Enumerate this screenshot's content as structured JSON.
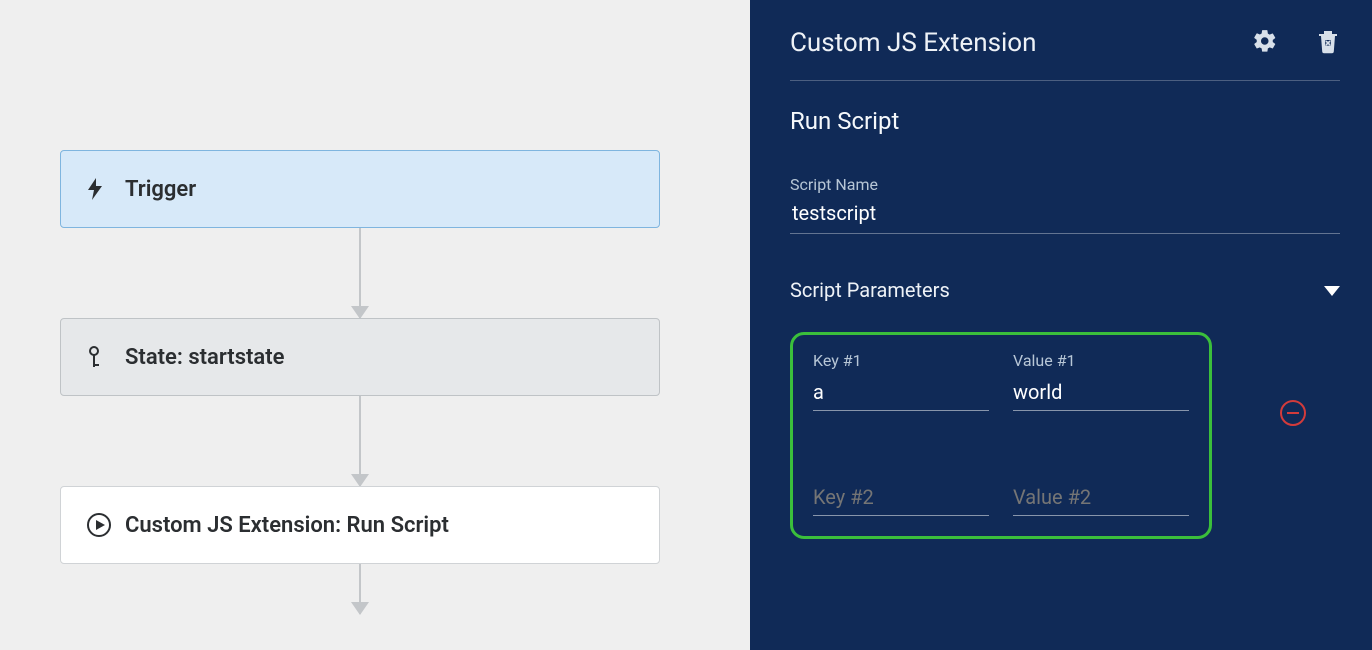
{
  "canvas": {
    "trigger": {
      "label": "Trigger"
    },
    "state": {
      "prefix": "State:",
      "name": "startstate",
      "full": "State: startstate"
    },
    "action": {
      "full": "Custom JS Extension: Run Script"
    }
  },
  "panel": {
    "title": "Custom JS Extension",
    "subtitle": "Run Script",
    "scriptName": {
      "label": "Script Name",
      "value": "testscript"
    },
    "paramsSection": "Script Parameters",
    "params": [
      {
        "keyLabel": "Key #1",
        "key": "a",
        "valueLabel": "Value #1",
        "value": "world"
      },
      {
        "keyLabel": "Key #2",
        "key": "",
        "valueLabel": "Value #2",
        "value": ""
      }
    ]
  }
}
